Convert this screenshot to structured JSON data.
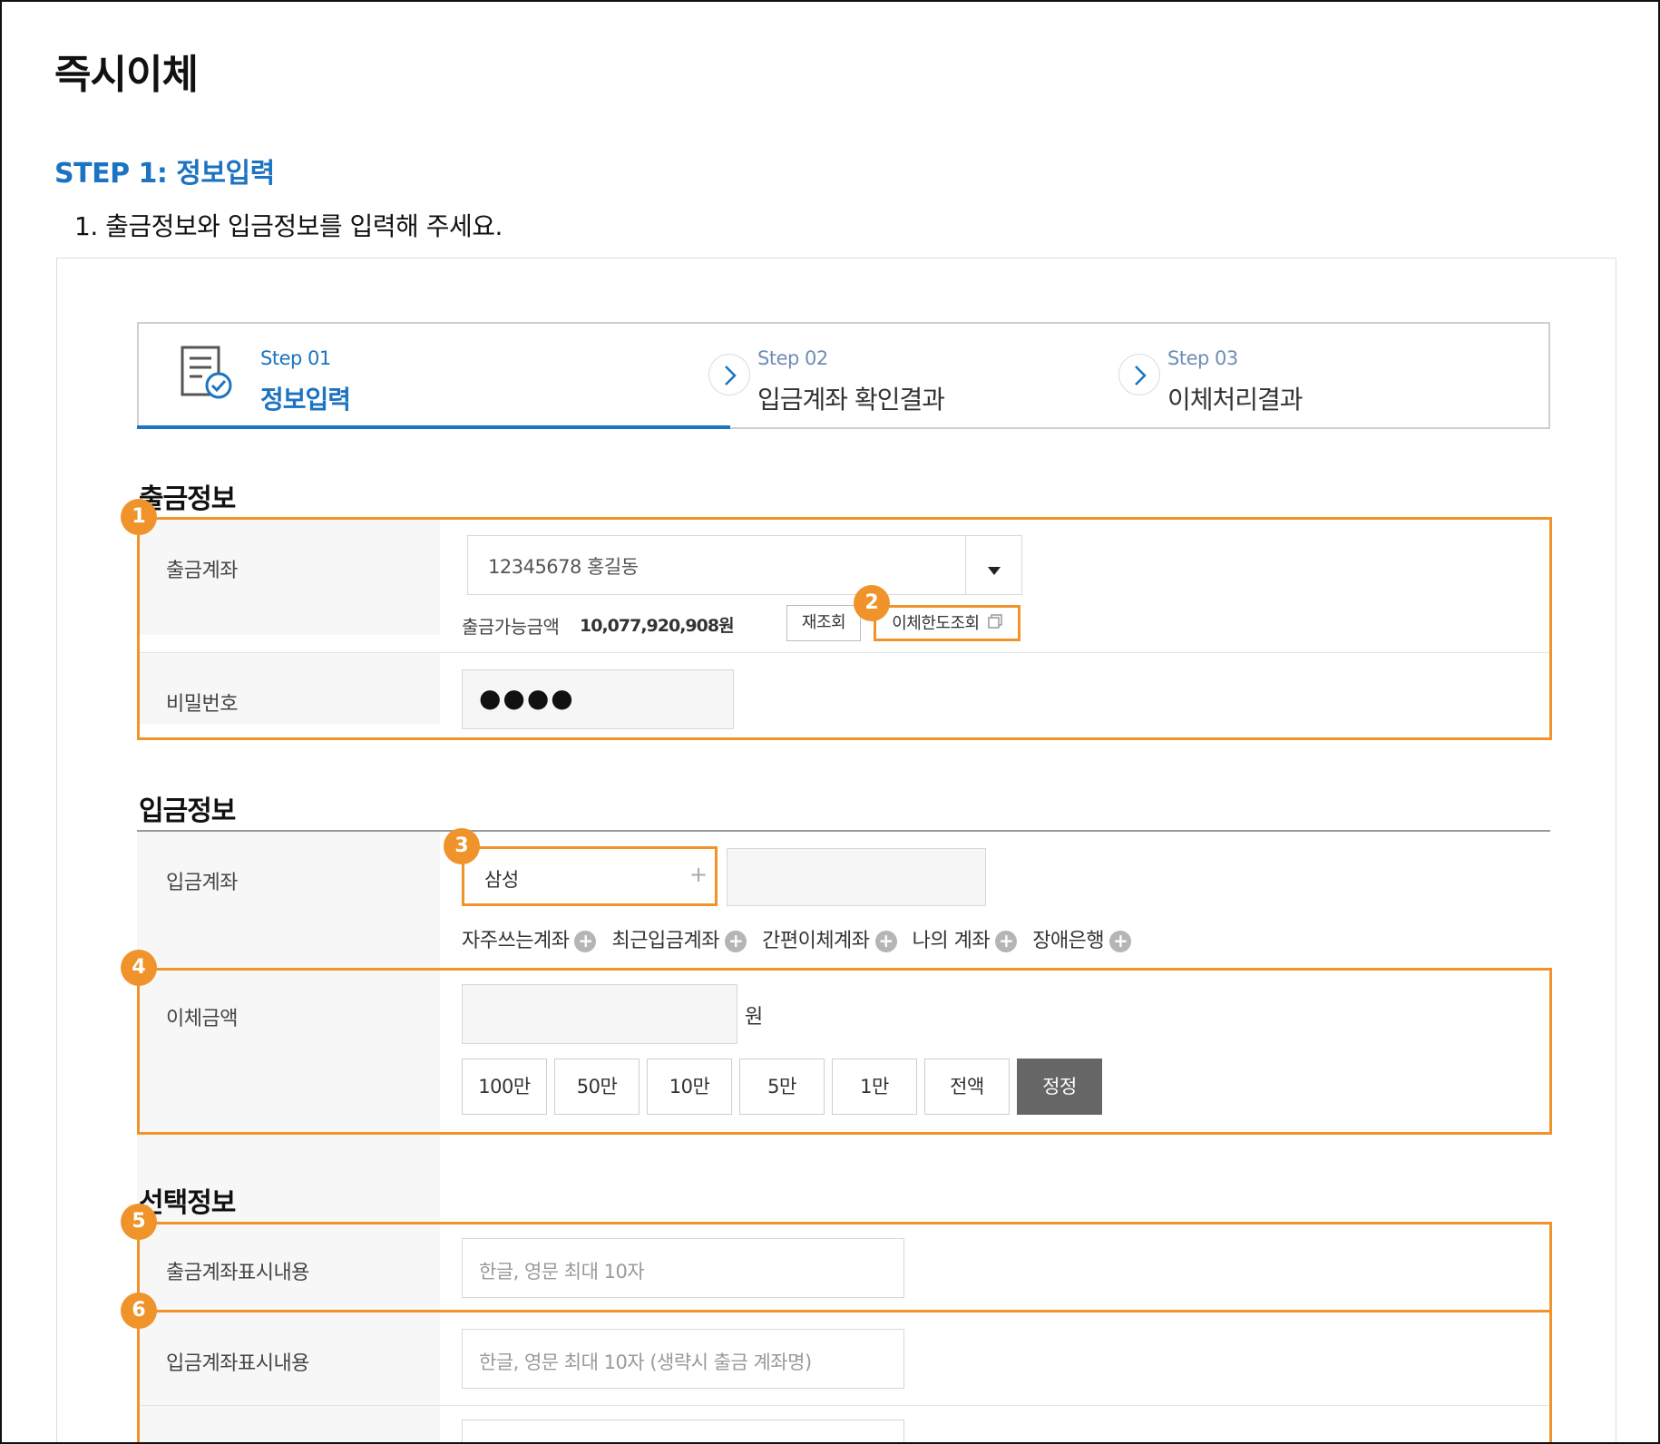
{
  "page": {
    "title": "즉시이체",
    "step_heading": "STEP 1: 정보입력",
    "instruction": "1. 출금정보와 입금정보를 입력해 주세요."
  },
  "stepper": {
    "steps": [
      {
        "label": "Step 01",
        "name": "정보입력",
        "active": true
      },
      {
        "label": "Step 02",
        "name": "입금계좌 확인결과",
        "active": false
      },
      {
        "label": "Step 03",
        "name": "이체처리결과",
        "active": false
      }
    ]
  },
  "withdrawal": {
    "title": "출금정보",
    "account_label": "출금계좌",
    "account_value": "12345678 홍길동",
    "balance_label": "출금가능금액",
    "balance_value": "10,077,920,908원",
    "refresh_button": "재조회",
    "limit_button": "이체한도조회",
    "password_label": "비밀번호",
    "password_value": "●●●●"
  },
  "deposit": {
    "title": "입금정보",
    "account_label": "입금계좌",
    "bank_value": "삼성",
    "shortcuts": [
      "자주쓰는계좌",
      "최근입금계좌",
      "간편이체계좌",
      "나의 계좌",
      "장애은행"
    ],
    "amount_label": "이체금액",
    "amount_unit": "원",
    "amount_buttons": [
      "100만",
      "50만",
      "10만",
      "5만",
      "1만",
      "전액",
      "정정"
    ]
  },
  "optional": {
    "title": "선택정보",
    "out_label": "출금계좌표시내용",
    "out_placeholder": "한글, 영문 최대 10자",
    "in_label": "입금계좌표시내용",
    "in_placeholder": "한글, 영문 최대 10자 (생략시 출금 계좌명)"
  },
  "badges": [
    "1",
    "2",
    "3",
    "4",
    "5",
    "6"
  ],
  "colors": {
    "accent_blue": "#1b73c1",
    "highlight_orange": "#f0932b",
    "correct_button": "#666666"
  }
}
